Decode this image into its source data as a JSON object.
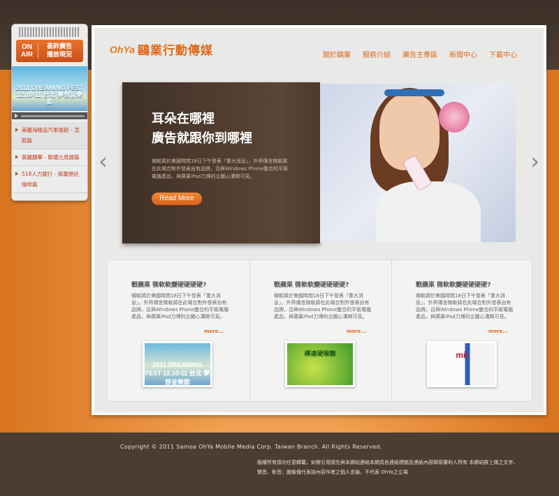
{
  "onair": {
    "logo_line1": "ON",
    "logo_line2": "AIR",
    "title_line1": "荟鈴廣告",
    "title_line2": "播放現況",
    "thumb_caption": "2011 DREAMING FEST 12.10-11 台北 夢想音樂節",
    "items": [
      {
        "label": "美麗海精品汽車旅館 - 渲館篇"
      },
      {
        "label": "萊麗翻攀 - 聯播元見證篇"
      },
      {
        "label": "518人力銀行 - 搞屢歷託咖啡篇"
      }
    ]
  },
  "header": {
    "logo_mark": "OhYa",
    "logo_text": "鷗業行動傳媒",
    "nav": [
      {
        "label": "關於鷗業"
      },
      {
        "label": "服務介紹"
      },
      {
        "label": "廣告主專區"
      },
      {
        "label": "新聞中心"
      },
      {
        "label": "下載中心"
      }
    ]
  },
  "hero": {
    "line1": "耳朵在哪裡",
    "line2": "廣告就跟你到哪裡",
    "desc": "微軟將於美國時間18日下午發表「重大消息」，外界傳言微軟將在此場合對外發表自有品牌，且與Windows Phone整合的平板電腦產品，與蘋果iPad力博的企圖心溝晰可見。",
    "read_more": "Read More",
    "prev": "‹",
    "next": "›"
  },
  "news": [
    {
      "title": "戰蘋果 微軟軟變硬硬硬硬?",
      "body": "微軟將於美國時間18日下午發表「重大消息」，外界傳言微軟將在此場合對外發表自有品牌，且與Windows Phone整合的平板電腦產品，與蘋果iPad力博的企圖心溝晰可見。",
      "more": "more...",
      "img_text": "2011 DREAMING FEST 12.10-11 台北 夢想音樂節"
    },
    {
      "title": "戰蘋果 微軟軟變硬硬硬硬?",
      "body": "微軟將於美國時間18日下午發表「重大消息」，外界傳言微軟將在此場合對外發表自有品牌，且與Windows Phone整合的平板電腦產品，與蘋果iPad力博的企圖心溝晰可見。",
      "more": "more...",
      "img_text": "樺達硬喉糖"
    },
    {
      "title": "戰蘋果 微軟軟變硬硬硬硬?",
      "body": "微軟將於美國時間18日下午發表「重大消息」，外界傳言微軟將在此場合對外發表自有品牌，且與Windows Phone整合的平板電腦產品，與蘋果iPad力博的企圖心溝晰可見。",
      "more": "more...",
      "img_text": "mii"
    }
  ],
  "footer": {
    "copyright": "Copyright © 2011 Samoa OhYa Mobile Media Corp. Taiwan Branch. All Rights Reserved.",
    "disclaimer": "版權所有請勿任意轉載，如需引用請先與本網站連絡本網頁各連結標題及連結內容歸原權利人所有 本網站群上傳之文字、聲音、影音；圖像僅代表該內容作者之個人言論，不代表 OhYa之立場"
  }
}
